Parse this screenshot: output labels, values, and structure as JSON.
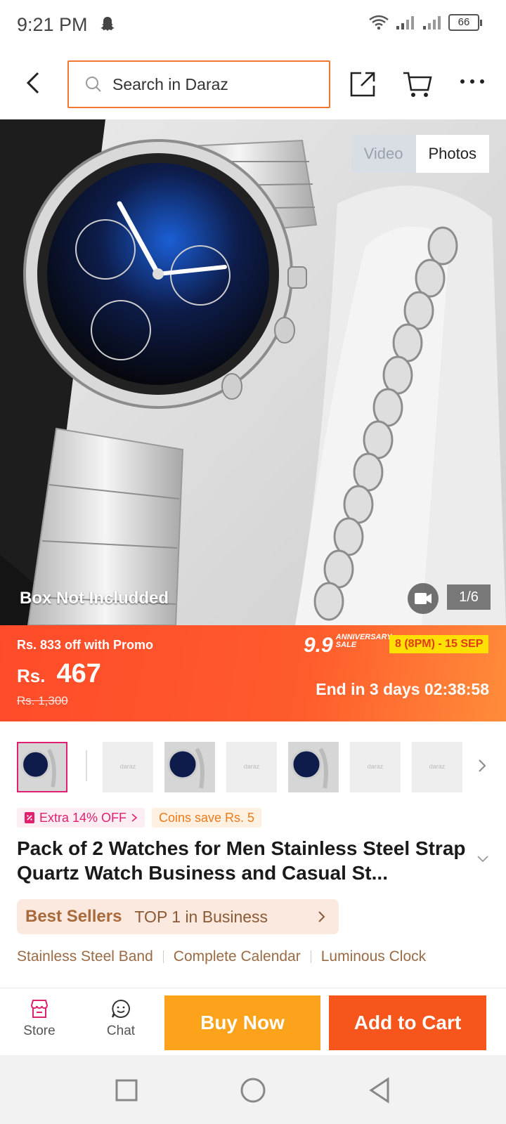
{
  "status_bar": {
    "time": "9:21 PM",
    "battery": "66"
  },
  "search": {
    "placeholder": "Search in Daraz"
  },
  "gallery": {
    "toggle_video": "Video",
    "toggle_photos": "Photos",
    "overlay_note": "Box Not Includded",
    "counter": "1/6"
  },
  "price_band": {
    "promo": "Rs. 833 off with Promo",
    "currency": "Rs.",
    "price": "467",
    "original_price": "Rs. 1,300",
    "sale_badge": "9.9",
    "sale_badge_sub": "ANNIVERSARY SALE",
    "sale_dates": "8 (8PM) - 15 SEP",
    "countdown": "End in 3 days 02:38:58",
    "accent_color": "#ff5b2c"
  },
  "thumbnails": {
    "selected_index": 0,
    "placeholder_label": "daraz"
  },
  "chips": {
    "extra_off": "Extra 14% OFF",
    "coins": "Coins save Rs. 5"
  },
  "product": {
    "title": "Pack of 2 Watches for Men Stainless Steel Strap Quartz Watch Business and Casual St..."
  },
  "best_sellers": {
    "label": "Best Sellers",
    "rank": "TOP 1 in Business"
  },
  "features": [
    "Stainless Steel Band",
    "Complete Calendar",
    "Luminous Clock"
  ],
  "bottom_bar": {
    "store": "Store",
    "chat": "Chat",
    "buy_now": "Buy Now",
    "add_to_cart": "Add to Cart",
    "buy_color": "#fda21b",
    "cart_color": "#f6561c"
  }
}
